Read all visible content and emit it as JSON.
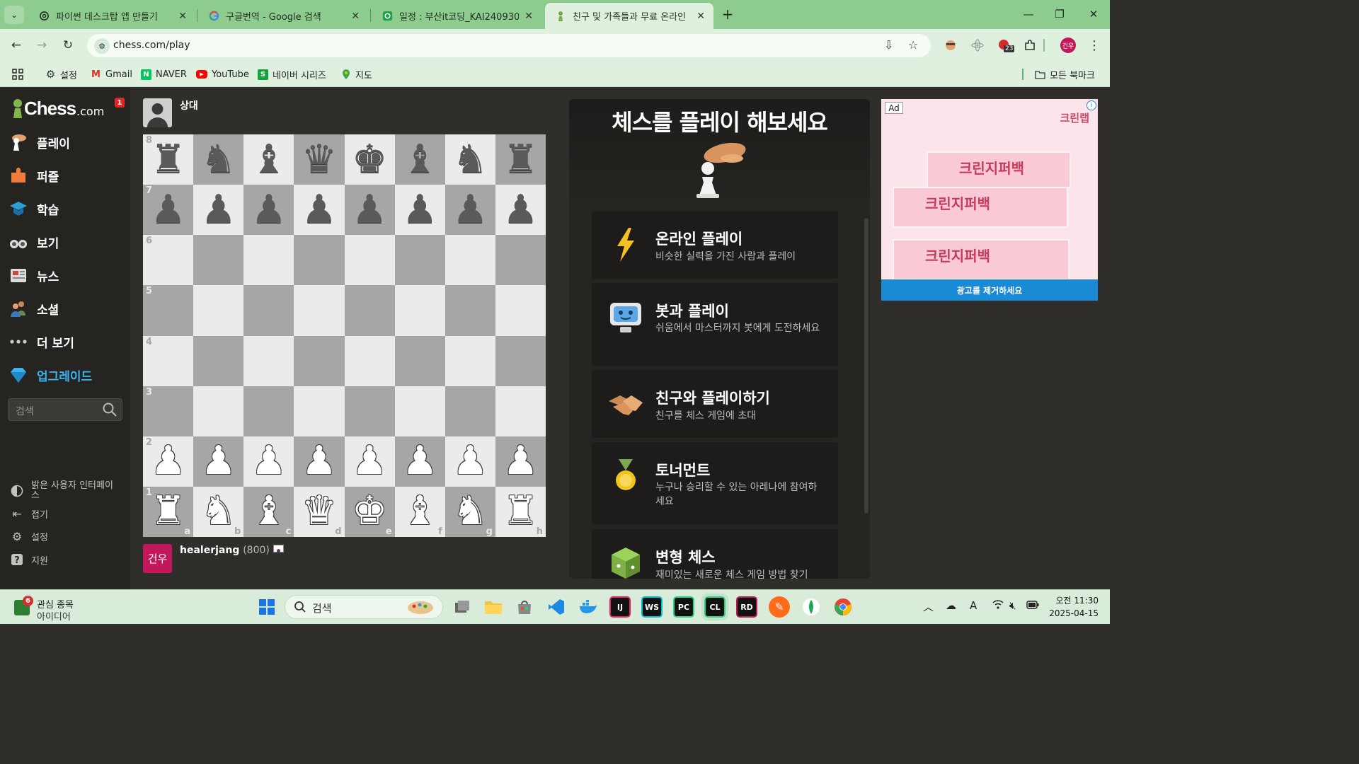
{
  "browser": {
    "tabs": [
      {
        "title": "파이썬 데스크탑 앱 만들기",
        "icon": "chatgpt-icon",
        "active": false
      },
      {
        "title": "구글번역 - Google 검색",
        "icon": "google-icon",
        "active": false
      },
      {
        "title": "일정 : 부산it코딩_KAI240930 | ",
        "icon": "green-app-icon",
        "active": false
      },
      {
        "title": "친구 및 가족들과 무료 온라인",
        "icon": "chess-pawn-icon",
        "active": true
      }
    ],
    "url": "chess.com/play",
    "extension_badge": "23",
    "profile_initials": "건우",
    "bookmarks": [
      "설정",
      "Gmail",
      "NAVER",
      "YouTube",
      "네이버 시리즈",
      "지도"
    ],
    "all_bookmarks": "모든 북마크"
  },
  "sidebar": {
    "logo_text": "Chess",
    "logo_suffix": ".com",
    "notification_count": "1",
    "items": [
      {
        "label": "플레이",
        "icon": "play-hand-pawn-icon"
      },
      {
        "label": "퍼즐",
        "icon": "puzzle-icon"
      },
      {
        "label": "학습",
        "icon": "learn-cap-icon"
      },
      {
        "label": "보기",
        "icon": "binoculars-icon"
      },
      {
        "label": "뉴스",
        "icon": "news-icon"
      },
      {
        "label": "소셜",
        "icon": "social-people-icon"
      },
      {
        "label": "더 보기",
        "icon": "more-dots-icon"
      },
      {
        "label": "업그레이드",
        "icon": "diamond-icon"
      }
    ],
    "search_placeholder": "검색",
    "bottom_items": [
      {
        "label": "밝은 사용자 인터페이스",
        "icon": "contrast-icon"
      },
      {
        "label": "접기",
        "icon": "collapse-icon"
      },
      {
        "label": "설정",
        "icon": "settings-gear-icon"
      },
      {
        "label": "지원",
        "icon": "help-icon"
      }
    ]
  },
  "game": {
    "opponent_name": "상대",
    "player_name": "healerjang",
    "player_rating": "(800)",
    "player_avatar_text": "건우",
    "ranks": [
      "8",
      "7",
      "6",
      "5",
      "4",
      "3",
      "2",
      "1"
    ],
    "files": [
      "a",
      "b",
      "c",
      "d",
      "e",
      "f",
      "g",
      "h"
    ],
    "position": [
      [
        "br",
        "bn",
        "bb",
        "bq",
        "bk",
        "bb",
        "bn",
        "br"
      ],
      [
        "bp",
        "bp",
        "bp",
        "bp",
        "bp",
        "bp",
        "bp",
        "bp"
      ],
      [
        "",
        "",
        "",
        "",
        "",
        "",
        "",
        ""
      ],
      [
        "",
        "",
        "",
        "",
        "",
        "",
        "",
        ""
      ],
      [
        "",
        "",
        "",
        "",
        "",
        "",
        "",
        ""
      ],
      [
        "",
        "",
        "",
        "",
        "",
        "",
        "",
        ""
      ],
      [
        "wp",
        "wp",
        "wp",
        "wp",
        "wp",
        "wp",
        "wp",
        "wp"
      ],
      [
        "wr",
        "wn",
        "wb",
        "wq",
        "wk",
        "wb",
        "wn",
        "wr"
      ]
    ]
  },
  "panel": {
    "title": "체스를 플레이 해보세요",
    "options": [
      {
        "title": "온라인 플레이",
        "subtitle": "비슷한 실력을 가진 사람과 플레이",
        "icon": "lightning-icon"
      },
      {
        "title": "봇과 플레이",
        "subtitle": "쉬움에서 마스터까지 봇에게 도전하세요",
        "icon": "robot-icon"
      },
      {
        "title": "친구와 플레이하기",
        "subtitle": "친구를 체스 게임에 초대",
        "icon": "handshake-icon"
      },
      {
        "title": "토너먼트",
        "subtitle": "누구나 승리할 수 있는 아레나에 참여하세요",
        "icon": "medal-icon"
      },
      {
        "title": "변형 체스",
        "subtitle": "재미있는 새로운 체스 게임 방법 찾기",
        "icon": "variant-dice-icon"
      }
    ]
  },
  "ad": {
    "label": "Ad",
    "brand": "크린랩",
    "product": "크린지퍼백",
    "remove_label": "광고를 제거하세요"
  },
  "taskbar": {
    "widget_badge": "6",
    "widget_line1": "관심 종목",
    "widget_line2": "아이디어",
    "search_placeholder": "검색",
    "time": "오전 11:30",
    "date": "2025-04-15"
  }
}
